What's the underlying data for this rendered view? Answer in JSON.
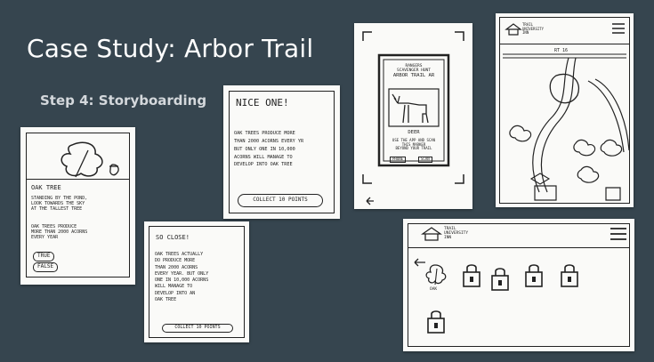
{
  "slide": {
    "title": "Case Study: Arbor Trail",
    "subtitle": "Step 4: Storyboarding"
  },
  "cards": {
    "oak_tree": {
      "heading": "Oak Tree",
      "line1": "Standing by the pond,",
      "line2": "look towards the sky",
      "line3": "at the tallest tree",
      "fact1": "Oak trees produce",
      "fact2": "more than 2000 acorns",
      "fact3": "every year",
      "true_label": "True",
      "false_label": "False"
    },
    "nice_one": {
      "heading": "Nice One!",
      "line1": "Oak trees produce more",
      "line2": "than 2000 acorns every yr",
      "line3": "but only one in 10,000",
      "line4": "acorns will manage to",
      "line5": "develop into oak tree",
      "button": "Collect 10 points"
    },
    "so_close": {
      "heading": "So Close!",
      "line1": "Oak trees actually",
      "line2": "do produce more",
      "line3": "than 2000 acorns",
      "line4": "every year. But only",
      "line5": "one in 10,000 acorns",
      "line6": "will manage to",
      "line7": "develop into an",
      "line8": "oak tree",
      "button": "Collect 10 points"
    },
    "ar_phone": {
      "top1": "Rangers",
      "top2": "Scavenger hunt",
      "top3": "Arbor Trail AR",
      "label": "Deer",
      "caption1": "Use the app and scan",
      "caption2": "this marker",
      "caption3": "Beyond your trail",
      "btn1": "Phone",
      "btn2": "Scan"
    },
    "map": {
      "brand1": "Trail",
      "brand2": "University",
      "brand3": "Inn",
      "road": "Rt 16"
    },
    "collection": {
      "brand1": "Trail",
      "brand2": "University",
      "brand3": "Inn",
      "leaf_label": "Oak"
    }
  }
}
